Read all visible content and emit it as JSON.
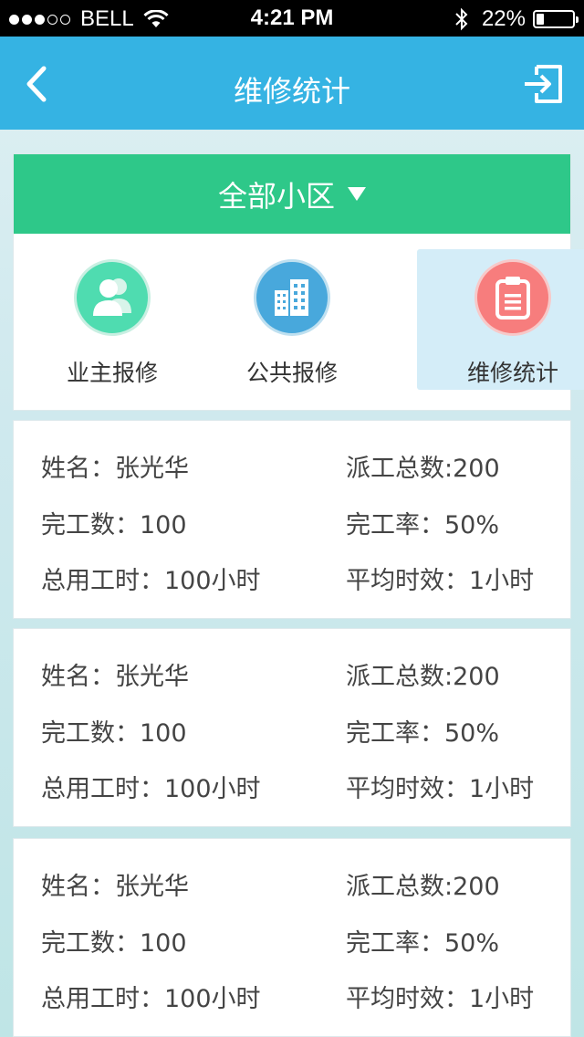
{
  "status_bar": {
    "carrier": "BELL",
    "signal_full": 3,
    "signal_empty": 2,
    "time": "4:21 PM",
    "battery_text": "22%",
    "battery_level": 0.22
  },
  "nav": {
    "title": "维修统计",
    "back_icon": "chevron-left-icon",
    "exit_icon": "exit-icon"
  },
  "community_selector": {
    "label": "全部小区",
    "icon": "caret-down-icon"
  },
  "menu": [
    {
      "label": "业主报修",
      "icon": "users-icon",
      "color": "#4fdcb0",
      "active": false
    },
    {
      "label": "公共报修",
      "icon": "building-icon",
      "color": "#48a8dc",
      "active": false
    },
    {
      "label": "维修统计",
      "icon": "clipboard-icon",
      "color": "#f77d7d",
      "active": true
    }
  ],
  "records": [
    {
      "name": "姓名：张光华",
      "dispatch": "派工总数:200",
      "completed": "完工数：100",
      "rate": "完工率：50%",
      "hours": "总用工时：100小时",
      "avg": "平均时效：1小时"
    },
    {
      "name": "姓名：张光华",
      "dispatch": "派工总数:200",
      "completed": "完工数：100",
      "rate": "完工率：50%",
      "hours": "总用工时：100小时",
      "avg": "平均时效：1小时"
    },
    {
      "name": "姓名：张光华",
      "dispatch": "派工总数:200",
      "completed": "完工数：100",
      "rate": "完工率：50%",
      "hours": "总用工时：100小时",
      "avg": "平均时效：1小时"
    }
  ],
  "colors": {
    "nav_bg": "#35b3e3",
    "selector_bg": "#2ec889",
    "active_menu_bg": "#d4edf8"
  }
}
